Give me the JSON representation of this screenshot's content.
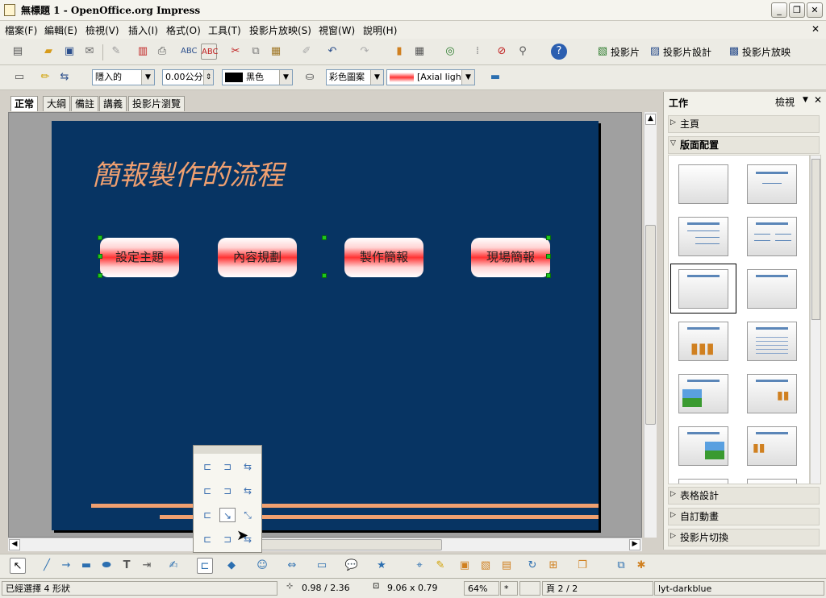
{
  "window": {
    "title": "無標題 1 - OpenOffice.org Impress",
    "minimize": "_",
    "restore": "❐",
    "close": "✕",
    "doc_close": "✕"
  },
  "menu": [
    "檔案(F)",
    "編輯(E)",
    "檢視(V)",
    "插入(I)",
    "格式(O)",
    "工具(T)",
    "投影片放映(S)",
    "視窗(W)",
    "說明(H)"
  ],
  "toolbar1": {
    "slide_btn": "投影片",
    "slide_design_btn": "投影片設計",
    "slideshow_btn": "投影片放映"
  },
  "toolbar2": {
    "area_style": "隱入的",
    "line_width": "0.00公分",
    "line_color": "黑色",
    "fill_type": "彩色圖案",
    "fill_value": "[Axial light"
  },
  "view_tabs": [
    "正常",
    "大綱",
    "備註",
    "講義",
    "投影片瀏覽"
  ],
  "slide": {
    "title": "簡報製作的流程",
    "steps": [
      "設定主題",
      "內容規劃",
      "製作簡報",
      "現場簡報"
    ]
  },
  "task_pane": {
    "title": "工作",
    "view_menu": "檢視",
    "close": "✕",
    "sections_top": [
      "主頁",
      "版面配置"
    ],
    "sections_bottom": [
      "表格設計",
      "自訂動畫",
      "投影片切換"
    ]
  },
  "status": {
    "selection": "已經選擇 4 形狀",
    "position": "0.98 / 2.36",
    "size": "9.06 x 0.79",
    "zoom": "64%",
    "modified": "*",
    "page": "頁 2 / 2",
    "layout_name": "lyt-darkblue"
  },
  "colors": {
    "slide_bg": "#073463",
    "title_color": "#f0a070",
    "accent_line": "#f0a070",
    "handle": "#1ec71e"
  }
}
